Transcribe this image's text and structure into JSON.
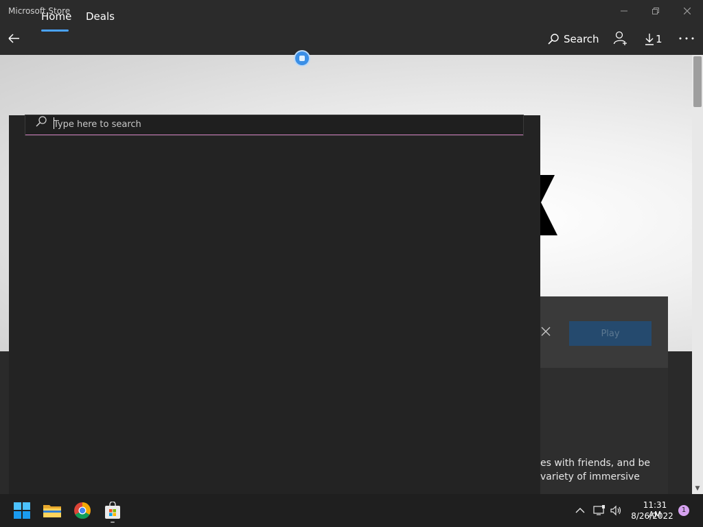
{
  "window": {
    "title": "Microsoft Store"
  },
  "nav": {
    "home_label": "Home",
    "deals_label": "Deals",
    "search_label": "Search",
    "downloads_count": "1"
  },
  "search": {
    "placeholder": "Type here to search"
  },
  "play_panel": {
    "play_label": "Play",
    "description_line1": "es with friends, and be",
    "description_line2": "variety of immersive"
  },
  "taskbar": {
    "time": "11:31 AM",
    "date": "8/26/2022",
    "notification_count": "1"
  },
  "colors": {
    "accent": "#4aa3ff",
    "title_bg": "#2b2b2b",
    "search_panel_bg": "#232323",
    "play_button_bg": "#254a6e"
  }
}
